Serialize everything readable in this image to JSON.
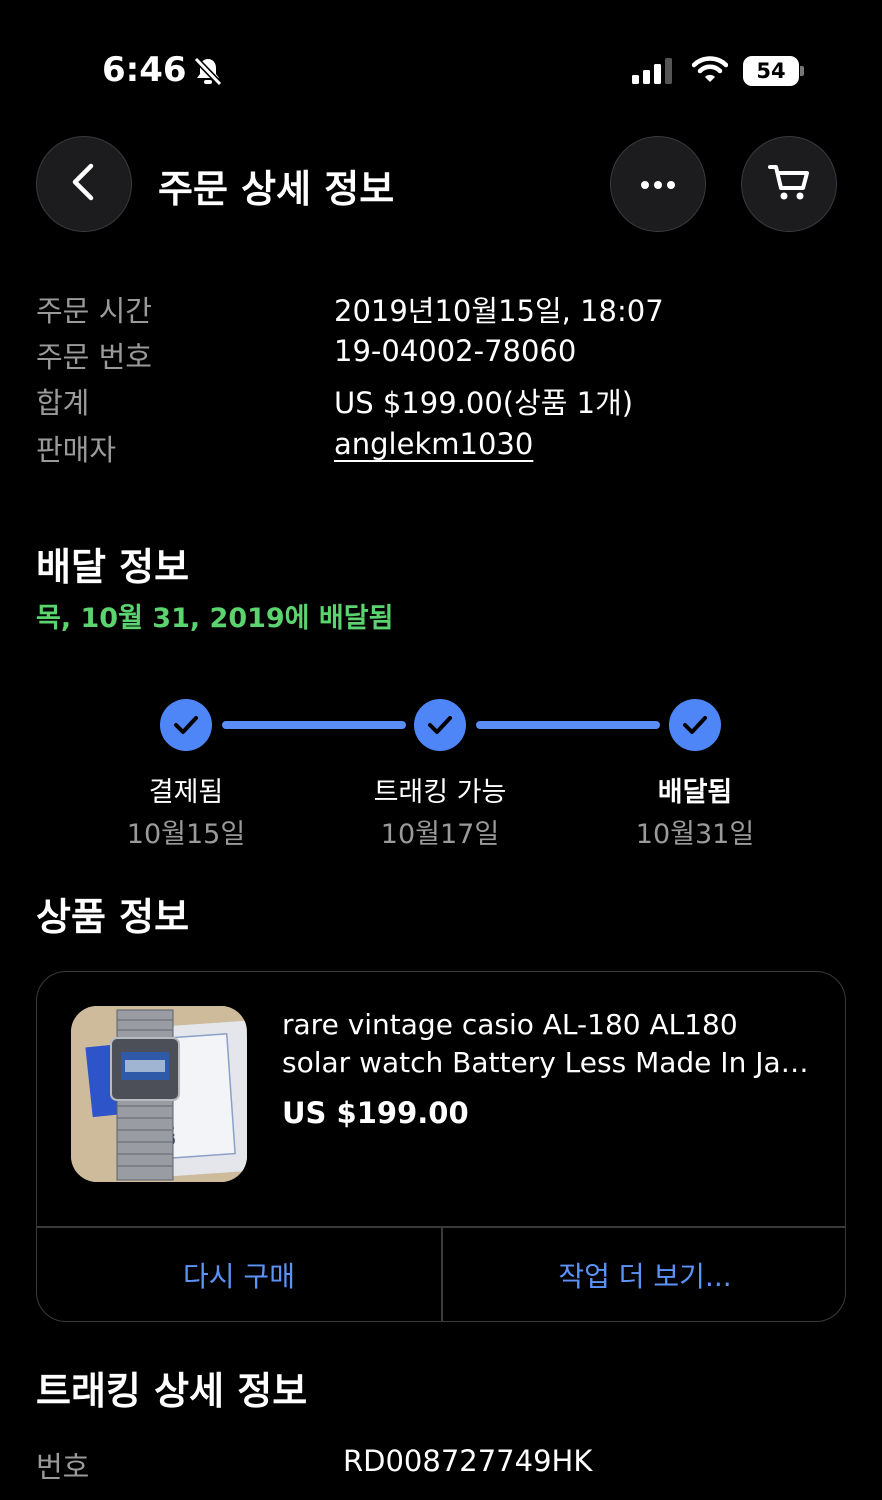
{
  "status_bar": {
    "time": "6:46",
    "battery": "54",
    "icons": [
      "bell-slash-icon",
      "cellular-signal-icon",
      "wifi-icon",
      "battery-icon"
    ]
  },
  "header": {
    "title": "주문 상세 정보",
    "icons": [
      "chevron-left-icon",
      "more-horizontal-icon",
      "cart-icon"
    ]
  },
  "order": {
    "rows": [
      {
        "label": "주문 시간",
        "value": "2019년10월15일, 18:07"
      },
      {
        "label": "주문 번호",
        "value": "19-04002-78060"
      },
      {
        "label": "합계",
        "value": "US $199.00(상품 1개)"
      },
      {
        "label": "판매자",
        "value": "anglekm1030"
      }
    ]
  },
  "delivery": {
    "title": "배달 정보",
    "status": "목, 10월 31, 2019에 배달됨",
    "status_color": "#5bd36e",
    "accent_color": "#4f86f7",
    "steps": [
      {
        "label": "결제됨",
        "date": "10월15일",
        "completed": true
      },
      {
        "label": "트래킹 가능",
        "date": "10월17일",
        "completed": true
      },
      {
        "label": "배달됨",
        "date": "10월31일",
        "completed": true
      }
    ]
  },
  "item": {
    "section_title": "상품 정보",
    "title_line1": "rare vintage casio AL-180 AL180",
    "title_line2": "solar watch Battery Less Made In Japan",
    "price": "US $199.00",
    "image_text": "CASIO",
    "actions": {
      "buy_again": "다시 구매",
      "more_actions": "작업 더 보기..."
    },
    "action_color": "#5c93f8"
  },
  "tracking": {
    "title": "트래킹 상세 정보",
    "label": "번호",
    "number": "RD008727749HK"
  }
}
